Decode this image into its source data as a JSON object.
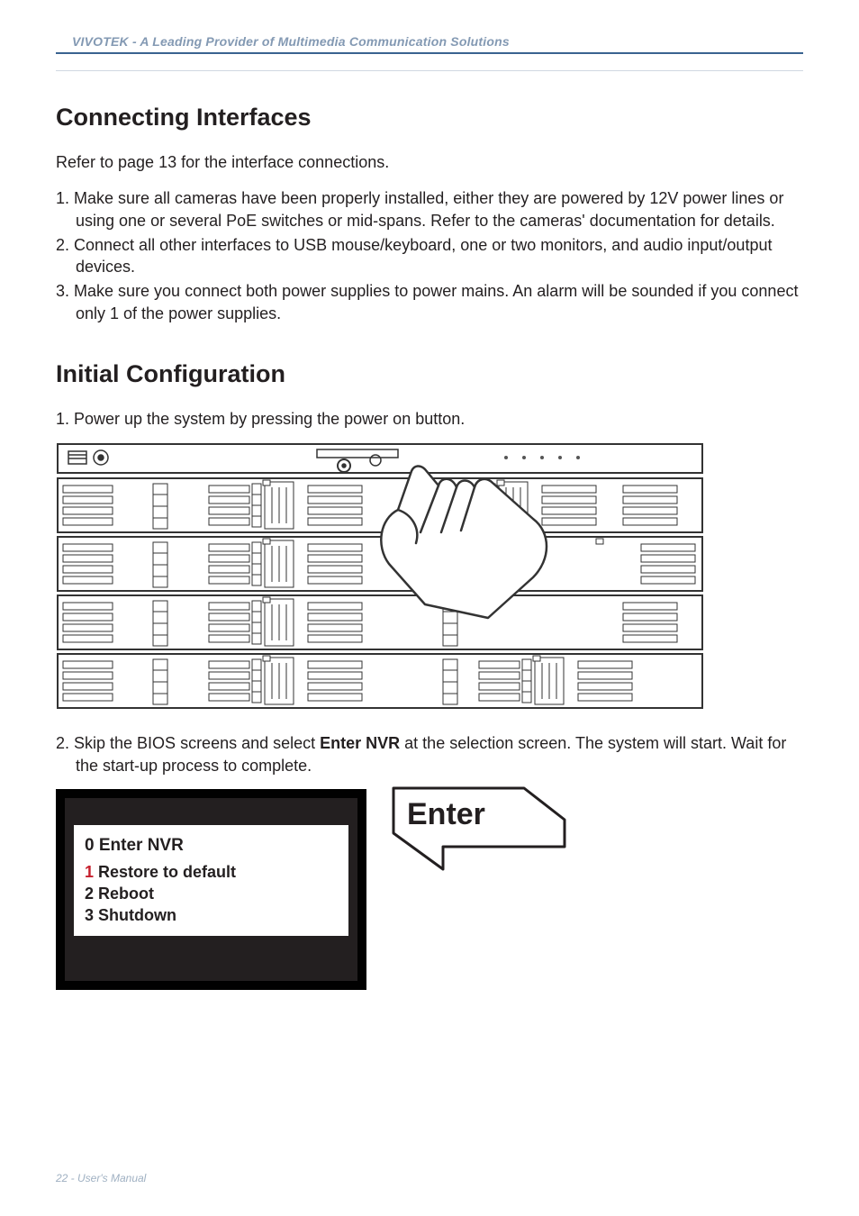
{
  "header": {
    "brand_line": "VIVOTEK - A Leading Provider of Multimedia Communication Solutions"
  },
  "section1": {
    "heading": "Connecting Interfaces",
    "intro": "Refer to page 13 for the interface connections.",
    "items": [
      "1. Make sure all cameras have been properly installed, either they are powered by 12V power lines or using one or several PoE switches or mid-spans. Refer to the cameras' documentation for details.",
      "2. Connect all other interfaces to USB mouse/keyboard, one or two monitors, and audio input/output devices.",
      "3. Make sure you connect both power supplies to power mains. An alarm will be sounded if you connect only 1 of the power supplies."
    ]
  },
  "section2": {
    "heading": "Initial Configuration",
    "step1": "1. Power up the system by pressing the power on button.",
    "step2_pre": "2. Skip the BIOS screens and select ",
    "step2_bold": "Enter NVR",
    "step2_post": " at the selection screen. The system will start. Wait for the start-up process to complete."
  },
  "boot": {
    "line0_num": "0",
    "line0_rest": " Enter NVR",
    "line1_num": "1",
    "line1_rest": " Restore to default",
    "line2": "2 Reboot",
    "line3": "3 Shutdown"
  },
  "enter_key_label": "Enter",
  "footer": {
    "text": "22 - User's Manual"
  }
}
